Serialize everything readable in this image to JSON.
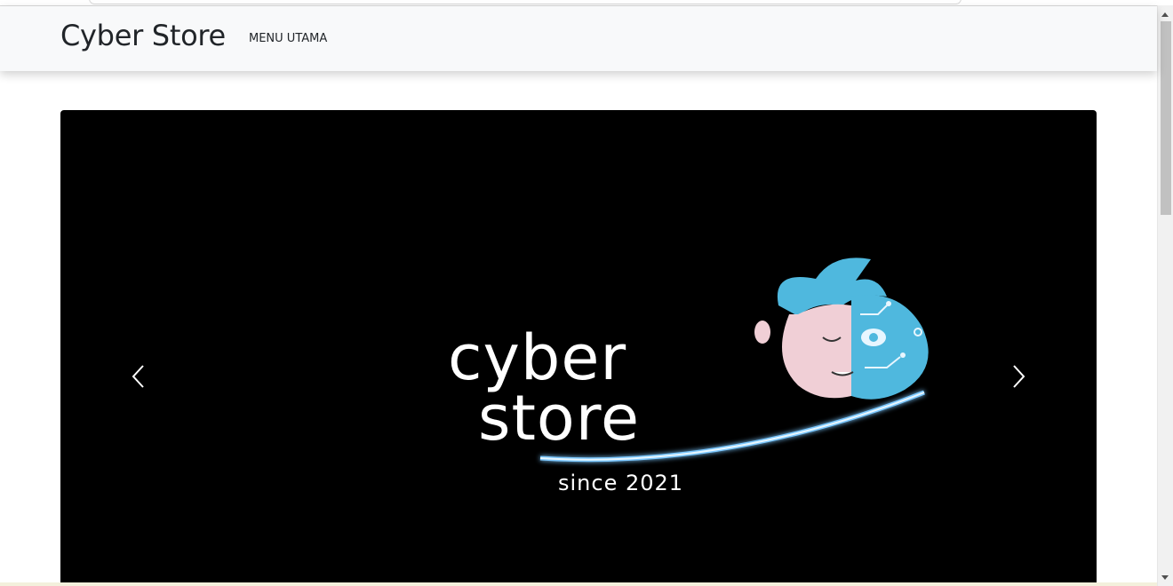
{
  "navbar": {
    "brand": "Cyber Store",
    "links": [
      {
        "label": "MENU UTAMA"
      }
    ]
  },
  "carousel": {
    "slide": {
      "logo_line1": "cyber",
      "logo_line2": "store",
      "tagline": "since 2021"
    },
    "prev_icon": "chevron-left-icon",
    "next_icon": "chevron-right-icon"
  },
  "colors": {
    "navbar_bg": "#f8f9fa",
    "carousel_bg": "#000000",
    "mascot_blue": "#4fb8de",
    "swoosh_glow": "#8fd3ff"
  }
}
